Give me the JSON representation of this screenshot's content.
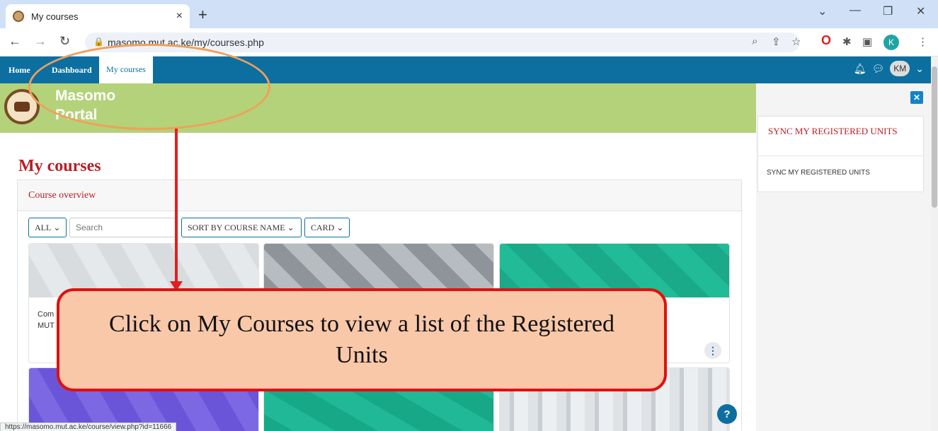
{
  "browser": {
    "tab_title": "My courses",
    "tab_close": "×",
    "new_tab": "+",
    "url": "masomo.mut.ac.ke/my/courses.php",
    "profile_initial": "K",
    "window_controls": [
      "⌄",
      "—",
      "❐",
      "✕"
    ],
    "status_url": "https://masomo.mut.ac.ke/course/view.php?id=11666"
  },
  "navbar": {
    "home": "Home",
    "dashboard": "Dashboard",
    "my_courses": "My courses",
    "avatar_initials": "KM"
  },
  "site": {
    "name_line1": "Masomo",
    "name_line2": "Portal"
  },
  "main": {
    "page_title": "My courses",
    "card_title": "Course overview",
    "filter_label": "ALL",
    "search_placeholder": "Search",
    "sort_label": "SORT BY COURSE NAME",
    "view_label": "CARD",
    "course_line1": "Com",
    "course_line2": "MUT"
  },
  "drawer": {
    "block_title": "SYNC MY REGISTERED UNITS",
    "block_text": "SYNC MY REGISTERED UNITS"
  },
  "annotation": {
    "callout_text": "Click on My Courses to view a list of the Registered Units"
  },
  "colors": {
    "navbar": "#0c6fa0",
    "banner": "#b3d27a",
    "accent_red": "#b72025",
    "callout_fill": "#f9c8a8",
    "callout_border": "#e01010",
    "oval": "#f0a05a"
  }
}
